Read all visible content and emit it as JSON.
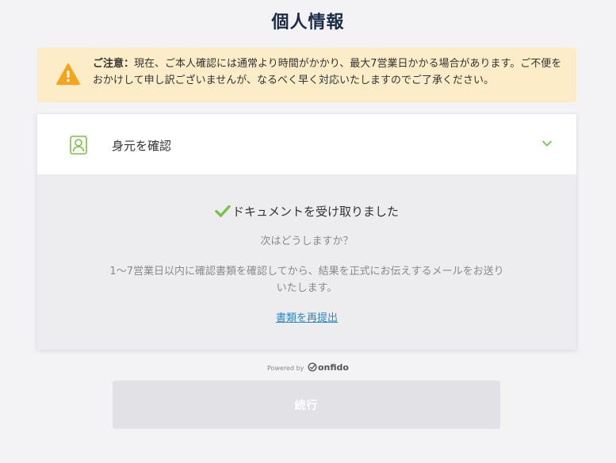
{
  "page": {
    "title": "個人情報"
  },
  "notice": {
    "label": "ご注意：",
    "text": "現在、ご本人確認には通常より時間がかかり、最大7営業日かかる場合があります。ご不便をおかけして申し訳ございませんが、なるべく早く対応いたしますのでご了承ください。",
    "icon": "warning-icon",
    "color": "#f7a41d"
  },
  "verify": {
    "header_label": "身元を確認",
    "person_icon": "person-id-icon",
    "chevron_icon": "chevron-down-icon",
    "accent": "#7cc04b",
    "received_text": "ドキュメントを受け取りました",
    "next_question": "次はどうしますか？",
    "description": "1〜7営業日以内に確認書類を確認してから、結果を正式にお伝えするメールをお送りいたします。",
    "resubmit_label": "書類を再提出"
  },
  "footer": {
    "powered_by": "Powered by",
    "brand": "onfido",
    "continue_label": "続行"
  }
}
